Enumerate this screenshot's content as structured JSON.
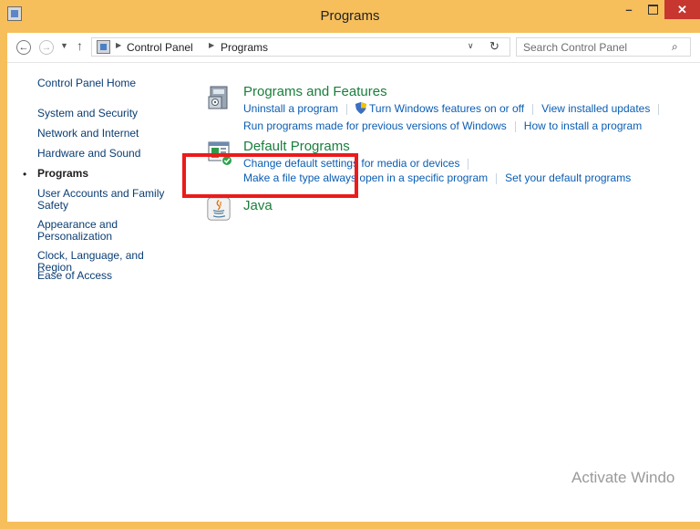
{
  "window": {
    "title": "Programs",
    "controls": {
      "minimize": "–",
      "maximize": "",
      "close": "✕"
    }
  },
  "address_bar": {
    "back_icon": "arrow-left-icon",
    "forward_icon": "arrow-right-icon",
    "breadcrumbs": [
      "Control Panel",
      "Programs"
    ],
    "search_placeholder": "Search Control Panel"
  },
  "sidebar": {
    "items": [
      {
        "label": "Control Panel Home",
        "current": false
      },
      {
        "label": "System and Security",
        "current": false
      },
      {
        "label": "Network and Internet",
        "current": false
      },
      {
        "label": "Hardware and Sound",
        "current": false
      },
      {
        "label": "Programs",
        "current": true
      },
      {
        "label": "User Accounts and Family Safety",
        "current": false
      },
      {
        "label": "Appearance and Personalization",
        "current": false
      },
      {
        "label": "Clock, Language, and Region",
        "current": false
      },
      {
        "label": "Ease of Access",
        "current": false
      }
    ]
  },
  "categories": [
    {
      "title": "Programs and Features",
      "icon": "programs-features-icon",
      "links": [
        [
          "Uninstall a program",
          "Turn Windows features on or off",
          "View installed updates"
        ],
        [
          "Run programs made for previous versions of Windows",
          "How to install a program"
        ]
      ]
    },
    {
      "title": "Default Programs",
      "icon": "default-programs-icon",
      "links": [
        [
          "Change default settings for media or devices"
        ],
        [
          "Make a file type always open in a specific program",
          "Set your default programs"
        ]
      ]
    },
    {
      "title": "Java",
      "icon": "java-icon",
      "links": []
    }
  ],
  "watermark": "Activate Windo",
  "colors": {
    "titlebar": "#f6bf5c",
    "close_button": "#c7372f",
    "category_title": "#1a7e3c",
    "link": "#0a5db3",
    "highlight_box": "#ec1a1a"
  }
}
